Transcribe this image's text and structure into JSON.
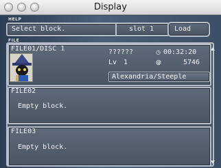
{
  "window": {
    "title": "Display"
  },
  "help": {
    "label": "HELP",
    "message": "Select block.",
    "slot": "slot 1",
    "load_label": "Load"
  },
  "file_panel": {
    "label": "FILE",
    "slots": [
      {
        "title": "FILE01/DISC 1",
        "name": "??????",
        "level_label": "Lv",
        "level": "1",
        "time": "00:32:20",
        "gil": "5746",
        "location": "Alexandria/Steeple"
      },
      {
        "title": "FILE02",
        "status": "Empty block."
      },
      {
        "title": "FILE03",
        "status": "Empty block."
      }
    ]
  },
  "icons": {
    "clock": "clock-icon",
    "gil": "gil-icon"
  },
  "colors": {
    "frame": "#b8bfc8",
    "panel": "#4a5563",
    "text": "#f2f2f2"
  }
}
